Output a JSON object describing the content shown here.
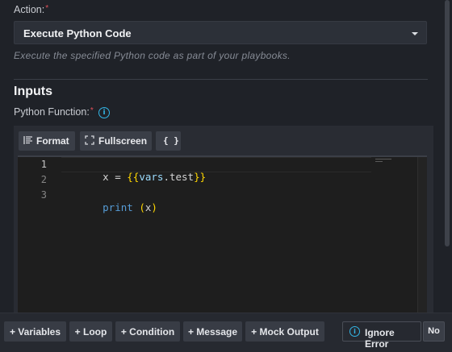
{
  "action": {
    "label": "Action:",
    "required_mark": "*",
    "selected": "Execute Python Code",
    "helper": "Execute the specified Python code as part of your playbooks."
  },
  "inputs": {
    "section_title": "Inputs",
    "python_function_label": "Python Function:",
    "required_mark": "*"
  },
  "editor_toolbar": {
    "format_label": "Format",
    "fullscreen_label": "Fullscreen",
    "braces_label": "{ }"
  },
  "code": {
    "line_numbers": [
      "1",
      "2",
      "3"
    ],
    "line1": {
      "var": "x",
      "op": " = ",
      "open": "{{",
      "expr": "vars",
      "dot": ".",
      "prop": "test",
      "close": "}}"
    },
    "line3": {
      "kw": "print",
      "sp": " ",
      "lp": "(",
      "arg": "x",
      "rp": ")"
    }
  },
  "bottom_bar": {
    "variables": "+ Variables",
    "loop": "+ Loop",
    "condition": "+ Condition",
    "message": "+ Message",
    "mock_output": "+ Mock Output",
    "ignore_error": "Ignore Error",
    "ignore_error_value": "No"
  },
  "icons": {
    "info": "info-circle-icon",
    "format": "format-lines-icon",
    "fullscreen": "fullscreen-corners-icon",
    "dropdown": "chevron-down-icon"
  },
  "colors": {
    "background": "#1f2228",
    "accent_info": "#33b6e6",
    "required": "#e0505a",
    "code_bg": "#1e1e1e"
  }
}
